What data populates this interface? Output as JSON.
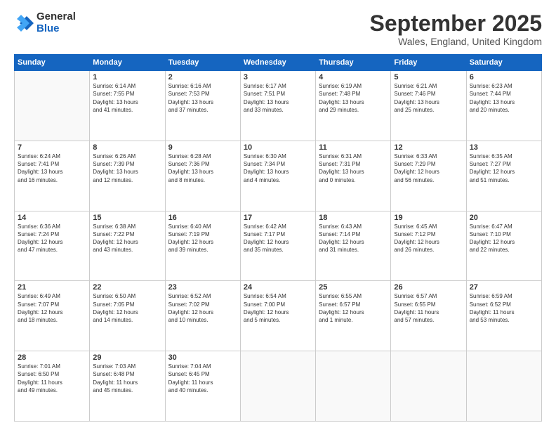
{
  "logo": {
    "general": "General",
    "blue": "Blue"
  },
  "header": {
    "month": "September 2025",
    "location": "Wales, England, United Kingdom"
  },
  "weekdays": [
    "Sunday",
    "Monday",
    "Tuesday",
    "Wednesday",
    "Thursday",
    "Friday",
    "Saturday"
  ],
  "weeks": [
    [
      {
        "day": "",
        "info": ""
      },
      {
        "day": "1",
        "info": "Sunrise: 6:14 AM\nSunset: 7:55 PM\nDaylight: 13 hours\nand 41 minutes."
      },
      {
        "day": "2",
        "info": "Sunrise: 6:16 AM\nSunset: 7:53 PM\nDaylight: 13 hours\nand 37 minutes."
      },
      {
        "day": "3",
        "info": "Sunrise: 6:17 AM\nSunset: 7:51 PM\nDaylight: 13 hours\nand 33 minutes."
      },
      {
        "day": "4",
        "info": "Sunrise: 6:19 AM\nSunset: 7:48 PM\nDaylight: 13 hours\nand 29 minutes."
      },
      {
        "day": "5",
        "info": "Sunrise: 6:21 AM\nSunset: 7:46 PM\nDaylight: 13 hours\nand 25 minutes."
      },
      {
        "day": "6",
        "info": "Sunrise: 6:23 AM\nSunset: 7:44 PM\nDaylight: 13 hours\nand 20 minutes."
      }
    ],
    [
      {
        "day": "7",
        "info": "Sunrise: 6:24 AM\nSunset: 7:41 PM\nDaylight: 13 hours\nand 16 minutes."
      },
      {
        "day": "8",
        "info": "Sunrise: 6:26 AM\nSunset: 7:39 PM\nDaylight: 13 hours\nand 12 minutes."
      },
      {
        "day": "9",
        "info": "Sunrise: 6:28 AM\nSunset: 7:36 PM\nDaylight: 13 hours\nand 8 minutes."
      },
      {
        "day": "10",
        "info": "Sunrise: 6:30 AM\nSunset: 7:34 PM\nDaylight: 13 hours\nand 4 minutes."
      },
      {
        "day": "11",
        "info": "Sunrise: 6:31 AM\nSunset: 7:31 PM\nDaylight: 13 hours\nand 0 minutes."
      },
      {
        "day": "12",
        "info": "Sunrise: 6:33 AM\nSunset: 7:29 PM\nDaylight: 12 hours\nand 56 minutes."
      },
      {
        "day": "13",
        "info": "Sunrise: 6:35 AM\nSunset: 7:27 PM\nDaylight: 12 hours\nand 51 minutes."
      }
    ],
    [
      {
        "day": "14",
        "info": "Sunrise: 6:36 AM\nSunset: 7:24 PM\nDaylight: 12 hours\nand 47 minutes."
      },
      {
        "day": "15",
        "info": "Sunrise: 6:38 AM\nSunset: 7:22 PM\nDaylight: 12 hours\nand 43 minutes."
      },
      {
        "day": "16",
        "info": "Sunrise: 6:40 AM\nSunset: 7:19 PM\nDaylight: 12 hours\nand 39 minutes."
      },
      {
        "day": "17",
        "info": "Sunrise: 6:42 AM\nSunset: 7:17 PM\nDaylight: 12 hours\nand 35 minutes."
      },
      {
        "day": "18",
        "info": "Sunrise: 6:43 AM\nSunset: 7:14 PM\nDaylight: 12 hours\nand 31 minutes."
      },
      {
        "day": "19",
        "info": "Sunrise: 6:45 AM\nSunset: 7:12 PM\nDaylight: 12 hours\nand 26 minutes."
      },
      {
        "day": "20",
        "info": "Sunrise: 6:47 AM\nSunset: 7:10 PM\nDaylight: 12 hours\nand 22 minutes."
      }
    ],
    [
      {
        "day": "21",
        "info": "Sunrise: 6:49 AM\nSunset: 7:07 PM\nDaylight: 12 hours\nand 18 minutes."
      },
      {
        "day": "22",
        "info": "Sunrise: 6:50 AM\nSunset: 7:05 PM\nDaylight: 12 hours\nand 14 minutes."
      },
      {
        "day": "23",
        "info": "Sunrise: 6:52 AM\nSunset: 7:02 PM\nDaylight: 12 hours\nand 10 minutes."
      },
      {
        "day": "24",
        "info": "Sunrise: 6:54 AM\nSunset: 7:00 PM\nDaylight: 12 hours\nand 5 minutes."
      },
      {
        "day": "25",
        "info": "Sunrise: 6:55 AM\nSunset: 6:57 PM\nDaylight: 12 hours\nand 1 minute."
      },
      {
        "day": "26",
        "info": "Sunrise: 6:57 AM\nSunset: 6:55 PM\nDaylight: 11 hours\nand 57 minutes."
      },
      {
        "day": "27",
        "info": "Sunrise: 6:59 AM\nSunset: 6:52 PM\nDaylight: 11 hours\nand 53 minutes."
      }
    ],
    [
      {
        "day": "28",
        "info": "Sunrise: 7:01 AM\nSunset: 6:50 PM\nDaylight: 11 hours\nand 49 minutes."
      },
      {
        "day": "29",
        "info": "Sunrise: 7:03 AM\nSunset: 6:48 PM\nDaylight: 11 hours\nand 45 minutes."
      },
      {
        "day": "30",
        "info": "Sunrise: 7:04 AM\nSunset: 6:45 PM\nDaylight: 11 hours\nand 40 minutes."
      },
      {
        "day": "",
        "info": ""
      },
      {
        "day": "",
        "info": ""
      },
      {
        "day": "",
        "info": ""
      },
      {
        "day": "",
        "info": ""
      }
    ]
  ]
}
